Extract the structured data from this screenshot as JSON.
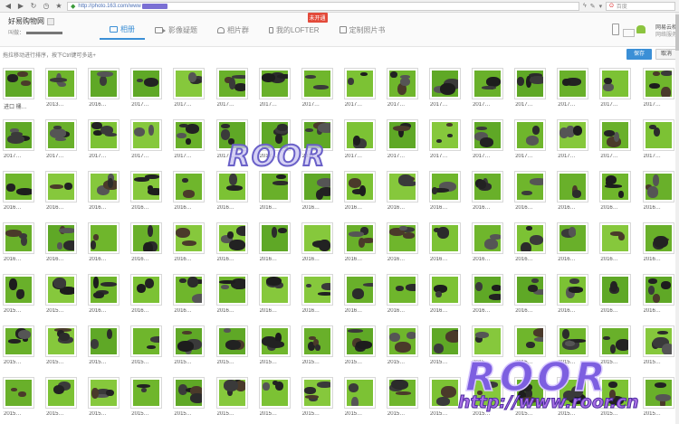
{
  "browser": {
    "url": "http://photo.163.com/www",
    "search_placeholder": "百度",
    "nav": [
      "back-icon",
      "forward-icon",
      "reload-icon",
      "history-icon",
      "star-icon"
    ]
  },
  "header": {
    "album_title": "好易购物网",
    "user_label": "叫做：",
    "tabs": [
      {
        "label": "相册",
        "icon": "photo-icon"
      },
      {
        "label": "影像疑题",
        "icon": "video-icon"
      },
      {
        "label": "相片群",
        "icon": "people-icon"
      },
      {
        "label": "我的LOFTER",
        "icon": "lofter-icon",
        "badge": "未开通"
      },
      {
        "label": "定制照片书",
        "icon": "book-icon"
      }
    ],
    "promo_title": "网易云相",
    "promo_sub": "网络服务"
  },
  "sort_bar": {
    "hint": "拖拉移动进行排序，按下Ctrl键可多选+",
    "save_label": "保存",
    "cancel_label": "取消"
  },
  "rows": [
    [
      "进口 桶…",
      "2013…",
      "2016…",
      "2017…",
      "2017…",
      "2017…",
      "2017…",
      "2017…",
      "2017…",
      "2017…",
      "2017…",
      "2017…",
      "2017…",
      "2017…",
      "2017…",
      "2017…"
    ],
    [
      "2017…",
      "2017…",
      "2017…",
      "2017…",
      "2017…",
      "2017…",
      "2017…",
      "2017…",
      "2017…",
      "2017…",
      "2017…",
      "2017…",
      "2017…",
      "2017…",
      "2017…",
      "2017…"
    ],
    [
      "2016…",
      "2016…",
      "2016…",
      "2016…",
      "2016…",
      "2016…",
      "2016…",
      "2016…",
      "2016…",
      "2016…",
      "2016…",
      "2016…",
      "2016…",
      "2016…",
      "2016…",
      "2016…"
    ],
    [
      "2016…",
      "2016…",
      "2016…",
      "2016…",
      "2016…",
      "2016…",
      "2016…",
      "2016…",
      "2016…",
      "2016…",
      "2016…",
      "2016…",
      "2016…",
      "2016…",
      "2016…",
      "2016…"
    ],
    [
      "2015…",
      "2015…",
      "2016…",
      "2016…",
      "2016…",
      "2016…",
      "2016…",
      "2016…",
      "2016…",
      "2016…",
      "2016…",
      "2016…",
      "2016…",
      "2016…",
      "2016…",
      "2016…"
    ],
    [
      "2015…",
      "2015…",
      "2015…",
      "2015…",
      "2015…",
      "2015…",
      "2015…",
      "2015…",
      "2015…",
      "2015…",
      "2015…",
      "2015…",
      "2015…",
      "2015…",
      "2015…",
      "2015…"
    ],
    [
      "2015…",
      "2015…",
      "2015…",
      "2015…",
      "2015…",
      "2015…",
      "2015…",
      "2015…",
      "2015…",
      "2015…",
      "2015…",
      "2015…",
      "2015…",
      "2015…",
      "2015…",
      "2015…"
    ]
  ],
  "watermark": {
    "center_text": "ROOR",
    "corner_text": "ROOR",
    "corner_url": "http://www.roor.cn"
  },
  "colors": {
    "accent": "#3b8fd6",
    "badge": "#e34a3a",
    "photo_green": "#6fb62c",
    "watermark": "#7d5fe0"
  }
}
